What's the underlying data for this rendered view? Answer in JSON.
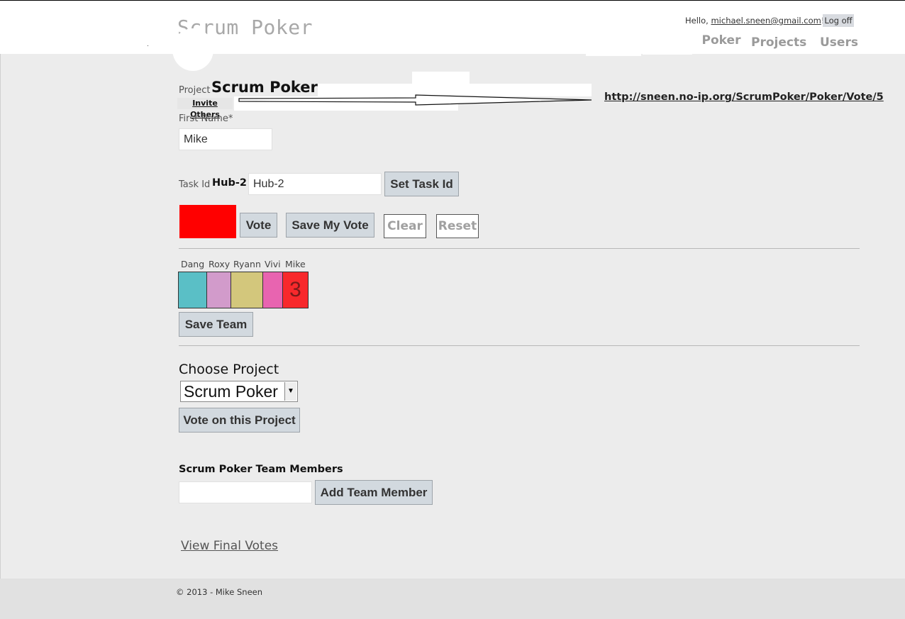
{
  "header": {
    "site_title": "Scrum Poker",
    "hello_prefix": "Hello, ",
    "user_email": "michael.sneen@gmail.com",
    "hello_suffix": "!",
    "logoff_label": "Log off",
    "nav": {
      "poker": "Poker",
      "projects": "Projects",
      "users": "Users"
    }
  },
  "project": {
    "label": "Project",
    "name": "Scrum Poker",
    "invite_label": "Invite Others",
    "vote_url": "http://sneen.no-ip.org/ScrumPoker/Poker/Vote/5"
  },
  "first_name": {
    "label": "First Name*",
    "value": "Mike"
  },
  "task": {
    "label": "Task Id",
    "current": "Hub-2",
    "input_value": "Hub-2",
    "set_button": "Set Task Id"
  },
  "vote_actions": {
    "selected_color": "#ff0000",
    "vote": "Vote",
    "save_my_vote": "Save My Vote",
    "clear": "Clear",
    "reset": "Reset"
  },
  "team": {
    "members": [
      {
        "name": "Dang",
        "color": "#5abfc6",
        "value": ""
      },
      {
        "name": "Roxy",
        "color": "#d29bcb",
        "value": ""
      },
      {
        "name": "Ryann",
        "color": "#d3c77c",
        "value": ""
      },
      {
        "name": "Vivi",
        "color": "#e864b0",
        "value": ""
      },
      {
        "name": "Mike",
        "color": "#f8292c",
        "value": "3"
      }
    ],
    "save_button": "Save Team"
  },
  "choose_project": {
    "label": "Choose Project",
    "selected": "Scrum Poker",
    "vote_button": "Vote on this Project"
  },
  "team_members": {
    "label": "Scrum Poker Team Members",
    "input_value": "",
    "add_button": "Add Team Member"
  },
  "links": {
    "view_final_votes": "View Final Votes"
  },
  "footer": {
    "copyright": "© 2013 - Mike Sneen"
  }
}
